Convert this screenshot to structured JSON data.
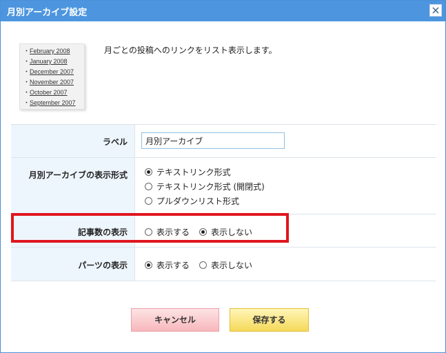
{
  "dialog": {
    "title": "月別アーカイブ設定"
  },
  "preview": {
    "items": [
      {
        "bullet": "・",
        "label": "February 2008"
      },
      {
        "bullet": "・",
        "label": "January 2008"
      },
      {
        "bullet": "・",
        "label": "December 2007"
      },
      {
        "bullet": "・",
        "label": "November 2007"
      },
      {
        "bullet": "・",
        "label": "October 2007"
      },
      {
        "bullet": "・",
        "label": "September 2007"
      }
    ]
  },
  "description": "月ごとの投稿へのリンクをリスト表示します。",
  "form": {
    "label_row": {
      "label": "ラベル",
      "value": "月別アーカイブ"
    },
    "format_row": {
      "label": "月別アーカイブの表示形式",
      "options": [
        "テキストリンク形式",
        "テキストリンク形式 (開閉式)",
        "プルダウンリスト形式"
      ],
      "selected": "テキストリンク形式"
    },
    "count_row": {
      "label": "記事数の表示",
      "options": [
        "表示する",
        "表示しない"
      ],
      "selected": "表示しない"
    },
    "parts_row": {
      "label": "パーツの表示",
      "options": [
        "表示する",
        "表示しない"
      ],
      "selected": "表示する"
    }
  },
  "buttons": {
    "cancel": "キャンセル",
    "save": "保存する"
  },
  "colors": {
    "titlebar": "#4d96df",
    "label_cell_bg": "#eef6fd",
    "highlight_border": "#e0151f",
    "cancel_bg": "#f7b8bc",
    "save_bg": "#f5d95a"
  },
  "icons": {
    "close": "close-icon"
  }
}
